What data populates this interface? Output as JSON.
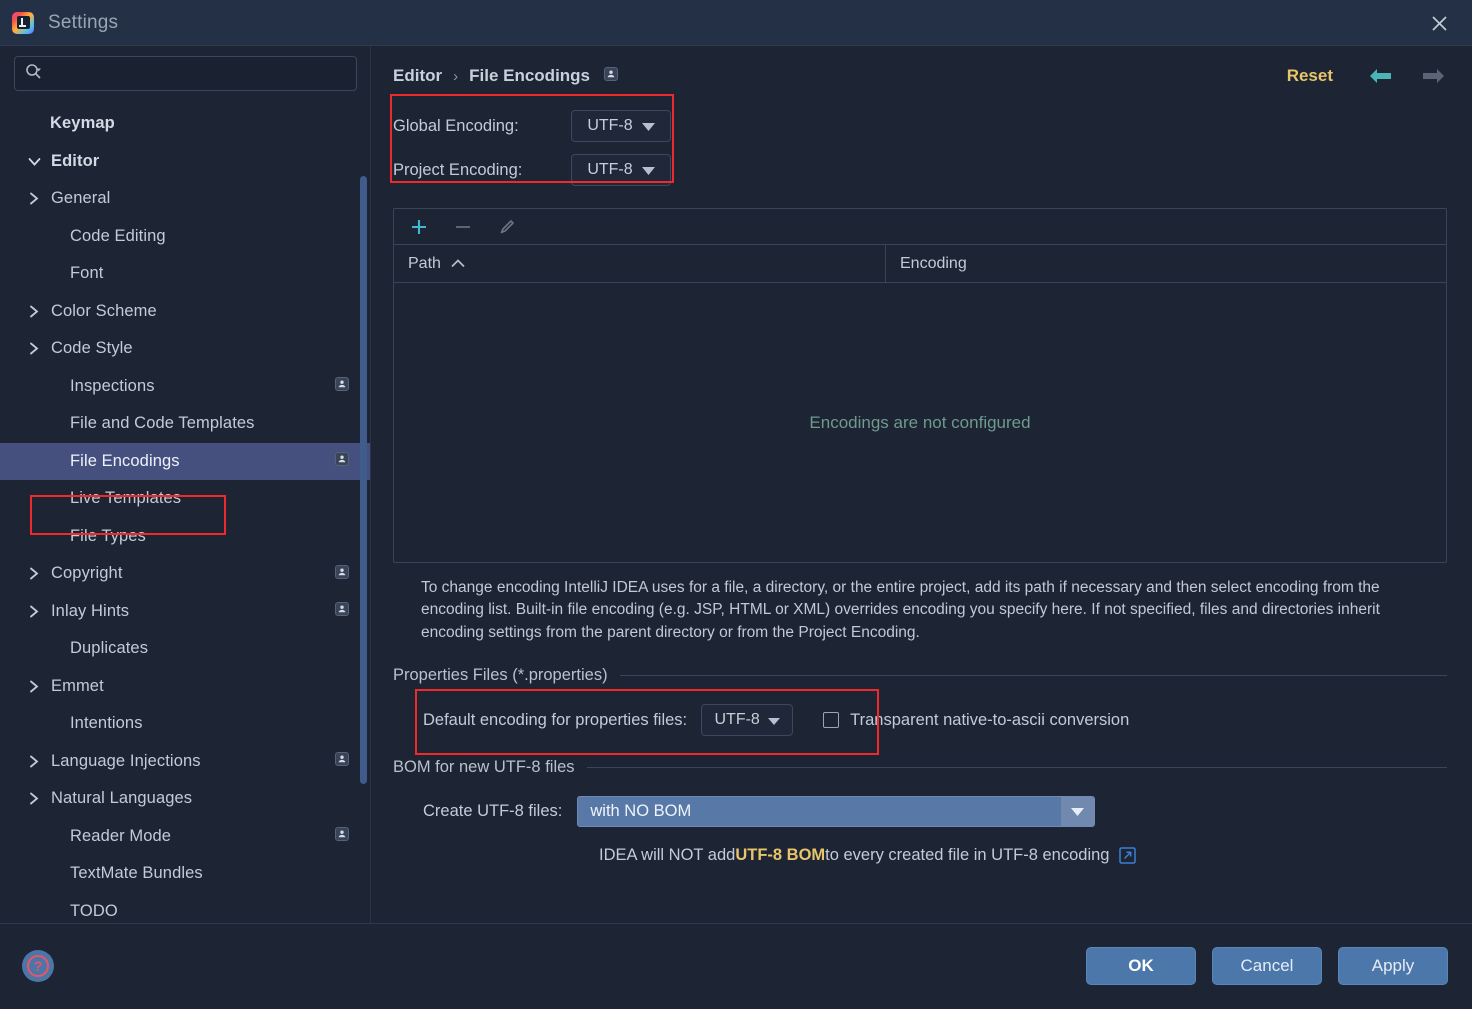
{
  "window": {
    "title": "Settings",
    "logo_icon": "intellij-idea-logo",
    "close_icon": "close-icon"
  },
  "sidebar": {
    "search": {
      "placeholder": "",
      "value": "",
      "icon": "search-icon"
    },
    "items": [
      {
        "label": "Keymap",
        "indent": 0,
        "bold": true,
        "arrow": "none",
        "badge": false,
        "selected": false
      },
      {
        "label": "Editor",
        "indent": 0,
        "bold": true,
        "arrow": "down",
        "badge": false,
        "selected": false
      },
      {
        "label": "General",
        "indent": 1,
        "bold": false,
        "arrow": "right",
        "badge": false,
        "selected": false
      },
      {
        "label": "Code Editing",
        "indent": 2,
        "bold": false,
        "arrow": "none",
        "badge": false,
        "selected": false
      },
      {
        "label": "Font",
        "indent": 2,
        "bold": false,
        "arrow": "none",
        "badge": false,
        "selected": false
      },
      {
        "label": "Color Scheme",
        "indent": 1,
        "bold": false,
        "arrow": "right",
        "badge": false,
        "selected": false
      },
      {
        "label": "Code Style",
        "indent": 1,
        "bold": false,
        "arrow": "right",
        "badge": false,
        "selected": false
      },
      {
        "label": "Inspections",
        "indent": 2,
        "bold": false,
        "arrow": "none",
        "badge": true,
        "selected": false
      },
      {
        "label": "File and Code Templates",
        "indent": 2,
        "bold": false,
        "arrow": "none",
        "badge": false,
        "selected": false
      },
      {
        "label": "File Encodings",
        "indent": 2,
        "bold": false,
        "arrow": "none",
        "badge": true,
        "selected": true
      },
      {
        "label": "Live Templates",
        "indent": 2,
        "bold": false,
        "arrow": "none",
        "badge": false,
        "selected": false
      },
      {
        "label": "File Types",
        "indent": 2,
        "bold": false,
        "arrow": "none",
        "badge": false,
        "selected": false
      },
      {
        "label": "Copyright",
        "indent": 1,
        "bold": false,
        "arrow": "right",
        "badge": true,
        "selected": false
      },
      {
        "label": "Inlay Hints",
        "indent": 1,
        "bold": false,
        "arrow": "right",
        "badge": true,
        "selected": false
      },
      {
        "label": "Duplicates",
        "indent": 2,
        "bold": false,
        "arrow": "none",
        "badge": false,
        "selected": false
      },
      {
        "label": "Emmet",
        "indent": 1,
        "bold": false,
        "arrow": "right",
        "badge": false,
        "selected": false
      },
      {
        "label": "Intentions",
        "indent": 2,
        "bold": false,
        "arrow": "none",
        "badge": false,
        "selected": false
      },
      {
        "label": "Language Injections",
        "indent": 1,
        "bold": false,
        "arrow": "right",
        "badge": true,
        "selected": false
      },
      {
        "label": "Natural Languages",
        "indent": 1,
        "bold": false,
        "arrow": "right",
        "badge": false,
        "selected": false
      },
      {
        "label": "Reader Mode",
        "indent": 2,
        "bold": false,
        "arrow": "none",
        "badge": true,
        "selected": false
      },
      {
        "label": "TextMate Bundles",
        "indent": 2,
        "bold": false,
        "arrow": "none",
        "badge": false,
        "selected": false
      },
      {
        "label": "TODO",
        "indent": 2,
        "bold": false,
        "arrow": "none",
        "badge": false,
        "selected": false
      }
    ]
  },
  "header": {
    "breadcrumb": [
      "Editor",
      "File Encodings"
    ],
    "separator": "›",
    "badge_icon": "project-settings-badge-icon",
    "reset_label": "Reset",
    "back_icon": "arrow-left-icon",
    "forward_icon": "arrow-right-icon"
  },
  "encodings": {
    "global_label": "Global Encoding:",
    "global_value": "UTF-8",
    "project_label": "Project Encoding:",
    "project_value": "UTF-8"
  },
  "table": {
    "toolbar": {
      "add_icon": "plus-icon",
      "remove_icon": "minus-icon",
      "edit_icon": "pencil-icon"
    },
    "columns": [
      "Path",
      "Encoding"
    ],
    "sort_indicator": "sort-ascending-icon",
    "rows": [],
    "empty_text": "Encodings are not configured"
  },
  "description": "To change encoding IntelliJ IDEA uses for a file, a directory, or the entire project, add its path if necessary and then select encoding from the encoding list. Built-in file encoding (e.g. JSP, HTML or XML) overrides encoding you specify here. If not specified, files and directories inherit encoding settings from the parent directory or from the Project Encoding.",
  "properties_section": {
    "title": "Properties Files (*.properties)",
    "default_encoding_label": "Default encoding for properties files:",
    "default_encoding_value": "UTF-8",
    "transparent_checkbox_label": "Transparent native-to-ascii conversion",
    "transparent_checkbox_checked": false
  },
  "bom_section": {
    "title": "BOM for new UTF-8 files",
    "create_label": "Create UTF-8 files:",
    "create_value": "with NO BOM",
    "note_prefix": "IDEA will NOT add ",
    "note_highlight": "UTF-8 BOM",
    "note_suffix": " to every created file in UTF-8 encoding",
    "external_link_icon": "external-link-icon"
  },
  "footer": {
    "help_icon": "help-question-icon",
    "ok_label": "OK",
    "cancel_label": "Cancel",
    "apply_label": "Apply"
  },
  "colors": {
    "background": "#1d2433",
    "titlebar": "#243046",
    "selection": "#45507f",
    "accent_blue": "#4b77ab",
    "reset_gold": "#e8c46a",
    "empty_text_green": "#6f9a8d",
    "highlight_red": "#ee2a2a",
    "toolbar_add_cyan": "#3fb8d4"
  }
}
